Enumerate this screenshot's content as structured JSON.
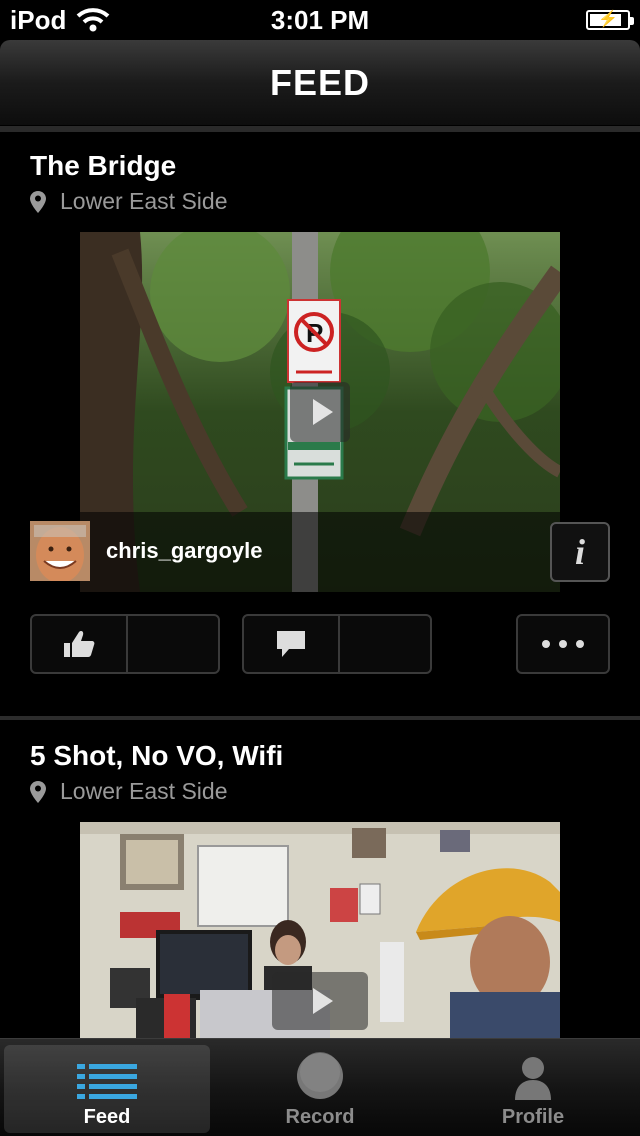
{
  "status_bar": {
    "carrier": "iPod",
    "time": "3:01 PM",
    "battery_level": 0.85
  },
  "nav": {
    "title": "FEED"
  },
  "feed": {
    "posts": [
      {
        "title": "The Bridge",
        "location": "Lower East Side",
        "username": "chris_gargoyle"
      },
      {
        "title": "5 Shot, No VO, Wifi",
        "location": "Lower East Side"
      }
    ]
  },
  "tab_bar": {
    "tabs": [
      {
        "label": "Feed",
        "icon": "list-icon",
        "selected": true
      },
      {
        "label": "Record",
        "icon": "record-icon",
        "selected": false
      },
      {
        "label": "Profile",
        "icon": "person-icon",
        "selected": false
      }
    ]
  },
  "colors": {
    "accent_blue": "#3aa7e0",
    "secondary_text": "#9a9a9a"
  }
}
